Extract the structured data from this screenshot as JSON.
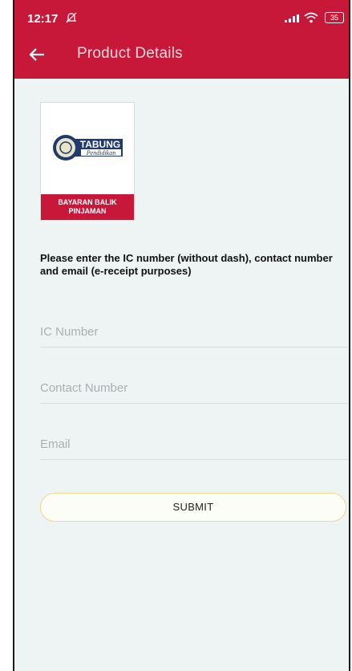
{
  "status_bar": {
    "time": "12:17",
    "battery": "35"
  },
  "header": {
    "title": "Product Details",
    "background": "#c8183a"
  },
  "product": {
    "logo_text": "TABUNG",
    "logo_subtext": "Pendidikan",
    "band_line1": "BAYARAN BALIK",
    "band_line2": "PINJAMAN"
  },
  "form": {
    "instruction": "Please enter the IC number (without dash), contact number and email (e-receipt purposes)",
    "ic_placeholder": "IC Number",
    "contact_placeholder": "Contact Number",
    "email_placeholder": "Email",
    "submit_label": "SUBMIT"
  }
}
